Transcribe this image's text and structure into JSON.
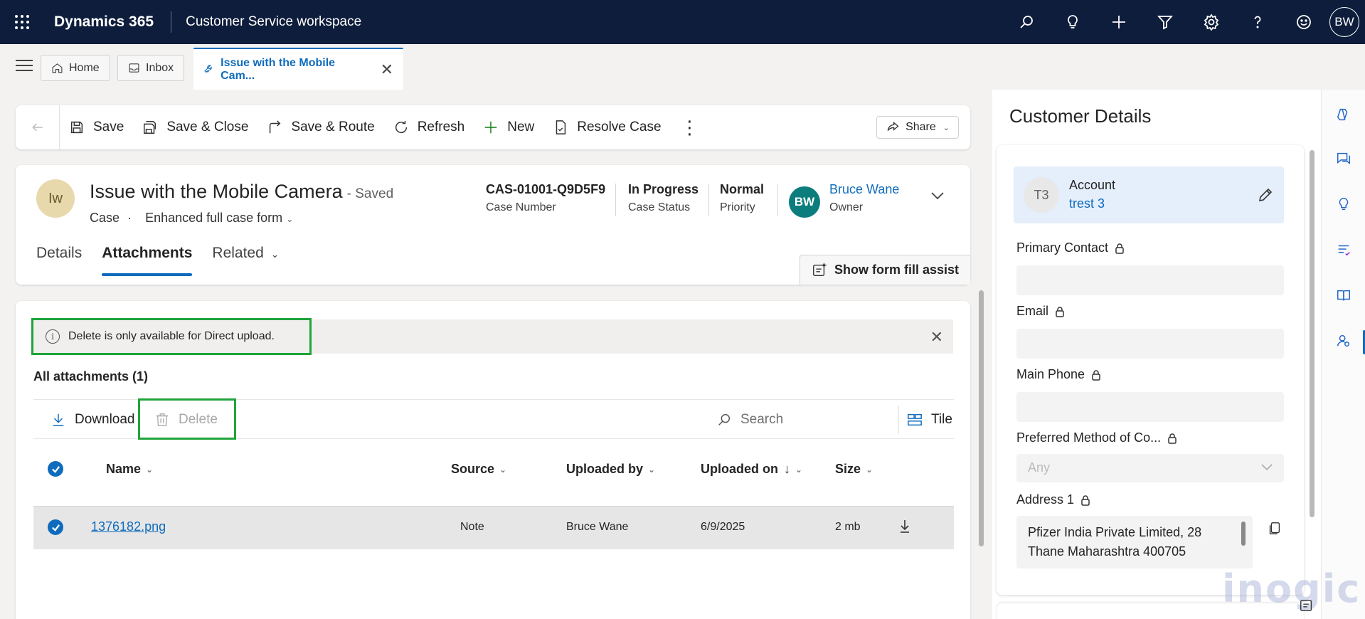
{
  "topbar": {
    "app_name": "Dynamics 365",
    "workspace": "Customer Service workspace",
    "user_initials": "BW",
    "icons": [
      "search-icon",
      "lightbulb-icon",
      "plus-icon",
      "filter-icon",
      "settings-icon",
      "help-icon",
      "smiley-icon"
    ]
  },
  "session_tabs": {
    "home": "Home",
    "inbox": "Inbox",
    "active": "Issue with the Mobile Cam..."
  },
  "commandbar": {
    "save": "Save",
    "save_close": "Save & Close",
    "save_route": "Save & Route",
    "refresh": "Refresh",
    "new": "New",
    "resolve": "Resolve Case",
    "more": "⋮",
    "share": "Share"
  },
  "record": {
    "avatar": "Iw",
    "title": "Issue with the Mobile Camera",
    "saved_status": "- Saved",
    "entity": "Case",
    "dot": "·",
    "form_name": "Enhanced full case form",
    "case_number_value": "CAS-01001-Q9D5F9",
    "case_number_label": "Case Number",
    "status_value": "In Progress",
    "status_label": "Case Status",
    "priority_value": "Normal",
    "priority_label": "Priority",
    "owner_initials": "BW",
    "owner_value": "Bruce Wane",
    "owner_label": "Owner"
  },
  "form_tabs": {
    "details": "Details",
    "attachments": "Attachments",
    "related": "Related",
    "fill_assist": "Show form fill assist"
  },
  "attachments": {
    "message": "Delete is only available for Direct upload.",
    "heading": "All attachments (1)",
    "download": "Download",
    "delete": "Delete",
    "search_placeholder": "Search",
    "tile": "Tile",
    "columns": {
      "name": "Name",
      "source": "Source",
      "uploaded_by": "Uploaded by",
      "uploaded_on": "Uploaded on",
      "sort_arrow": "↓",
      "size": "Size"
    },
    "rows": [
      {
        "name": "1376182.png",
        "source": "Note",
        "uploaded_by": "Bruce Wane",
        "uploaded_on": "6/9/2025",
        "size": "2 mb"
      }
    ]
  },
  "customer_panel": {
    "title": "Customer Details",
    "account_avatar": "T3",
    "account_label": "Account",
    "account_value": "trest 3",
    "primary_contact_label": "Primary Contact",
    "email_label": "Email",
    "main_phone_label": "Main Phone",
    "preferred_method_label": "Preferred Method of Co...",
    "preferred_method_value": "Any",
    "address_label": "Address 1",
    "address_line1": "Pfizer India Private Limited, 28",
    "address_line2": "Thane Maharashtra 400705"
  },
  "watermark": "inogic",
  "colors": {
    "nav_bg": "#0e1d3b",
    "accent": "#0f6cbd",
    "highlight_box": "#1fa43a",
    "owner_avatar": "#0c7d7d"
  }
}
